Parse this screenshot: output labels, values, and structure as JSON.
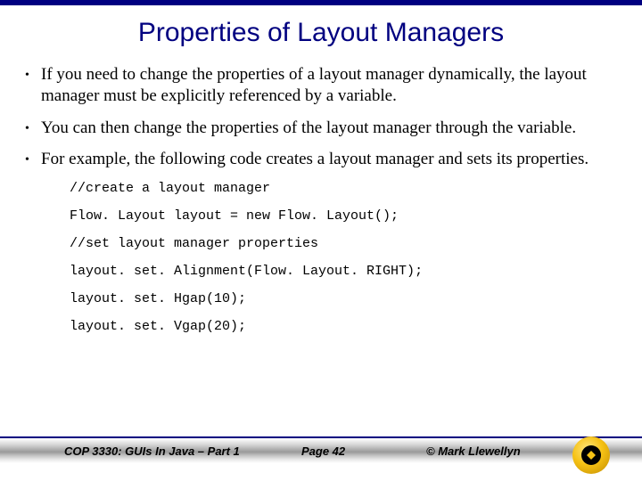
{
  "title": "Properties of Layout Managers",
  "bullets": [
    "If you need to change the properties of a layout manager dynamically, the layout manager must be explicitly referenced by a variable.",
    "You can then change the properties of the layout manager through the variable.",
    "For example, the following code creates a layout manager and sets its properties."
  ],
  "code": [
    "//create a layout manager",
    "Flow. Layout layout = new Flow. Layout();",
    "//set layout manager properties",
    "layout. set. Alignment(Flow. Layout. RIGHT);",
    "layout. set. Hgap(10);",
    "layout. set. Vgap(20);"
  ],
  "footer": {
    "course": "COP 3330:  GUIs In Java – Part 1",
    "page": "Page 42",
    "copyright": "© Mark Llewellyn"
  }
}
